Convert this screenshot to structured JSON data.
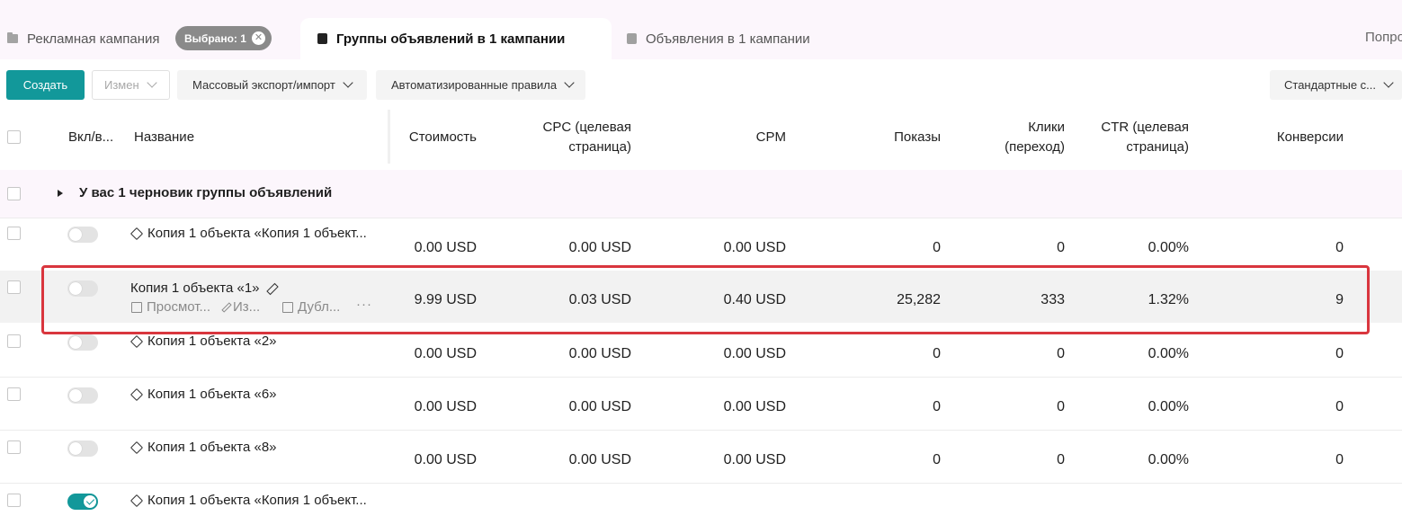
{
  "tabs": {
    "campaign": "Рекламная кампания",
    "selected_badge": "Выбрано: 1",
    "ad_groups": "Группы объявлений в 1 кампании",
    "ads": "Объявления в 1 кампании",
    "right_truncated": "Попро"
  },
  "toolbar": {
    "create": "Создать",
    "edit": "Измен",
    "export": "Массовый экспорт/импорт",
    "rules": "Автоматизированные правила",
    "standard": "Стандартные с..."
  },
  "table": {
    "headers": {
      "toggle": "Вкл/в...",
      "name": "Название",
      "cost": "Стоимость",
      "cpc_1": "CPC (целевая",
      "cpc_2": "страница)",
      "cpm": "CPM",
      "impressions": "Показы",
      "clicks_1": "Клики",
      "clicks_2": "(переход)",
      "ctr_1": "CTR (целевая",
      "ctr_2": "страница)",
      "conversions": "Конверсии"
    },
    "draft_row": "У вас 1 черновик группы объявлений",
    "rows": [
      {
        "name": "Копия 1 объекта «Копия 1 объект...",
        "cost": "0.00 USD",
        "cpc": "0.00 USD",
        "cpm": "0.00 USD",
        "impressions": "0",
        "clicks": "0",
        "ctr": "0.00%",
        "conversions": "0",
        "on": false
      },
      {
        "name": "Копия 1 объекта «1»",
        "cost": "9.99 USD",
        "cpc": "0.03 USD",
        "cpm": "0.40 USD",
        "impressions": "25,282",
        "clicks": "333",
        "ctr": "1.32%",
        "conversions": "9",
        "on": false
      },
      {
        "name": "Копия 1 объекта «2»",
        "cost": "0.00 USD",
        "cpc": "0.00 USD",
        "cpm": "0.00 USD",
        "impressions": "0",
        "clicks": "0",
        "ctr": "0.00%",
        "conversions": "0",
        "on": false
      },
      {
        "name": "Копия 1 объекта «6»",
        "cost": "0.00 USD",
        "cpc": "0.00 USD",
        "cpm": "0.00 USD",
        "impressions": "0",
        "clicks": "0",
        "ctr": "0.00%",
        "conversions": "0",
        "on": false
      },
      {
        "name": "Копия 1 объекта «8»",
        "cost": "0.00 USD",
        "cpc": "0.00 USD",
        "cpm": "0.00 USD",
        "impressions": "0",
        "clicks": "0",
        "ctr": "0.00%",
        "conversions": "0",
        "on": false
      },
      {
        "name": "Копия 1 объекта «Копия 1 объект...",
        "on": true
      }
    ],
    "row_actions": {
      "view": "Просмот...",
      "edit": "Из...",
      "duplicate": "Дубл...",
      "more": "···"
    }
  },
  "colors": {
    "accent": "#12989a",
    "highlight_frame": "#d9363e",
    "tab_bar_bg": "#fcf6fc"
  }
}
